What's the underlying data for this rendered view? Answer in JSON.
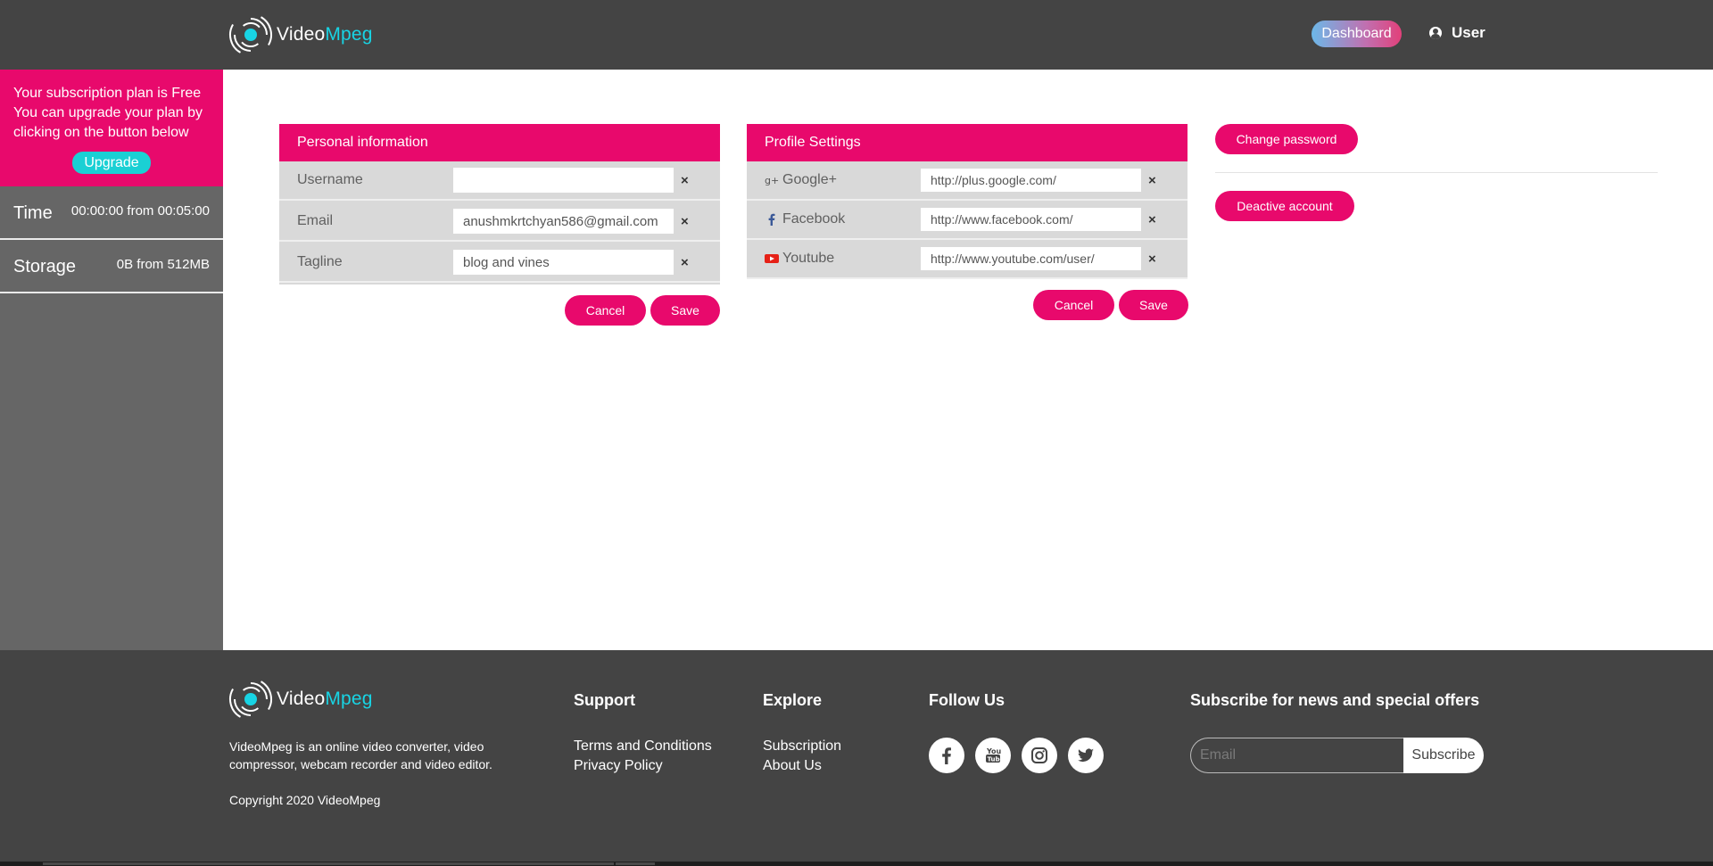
{
  "brand": {
    "name_part1": "Video",
    "name_part2": "Mpeg"
  },
  "header": {
    "dashboard_label": "Dashboard",
    "user_label": "User"
  },
  "sidebar": {
    "plan_text": "Your subscription plan is Free You can upgrade your plan by clicking on the button below",
    "upgrade_label": "Upgrade",
    "time_label": "Time",
    "time_value": "00:00:00 from 00:05:00",
    "storage_label": "Storage",
    "storage_value": "0B from 512MB"
  },
  "personal_info": {
    "title": "Personal information",
    "fields": [
      {
        "label": "Username",
        "value": ""
      },
      {
        "label": "Email",
        "value": "anushmkrtchyan586@gmail.com"
      },
      {
        "label": "Tagline",
        "value": "blog and vines"
      }
    ],
    "clear_symbol": "×",
    "cancel_label": "Cancel",
    "save_label": "Save"
  },
  "profile_settings": {
    "title": "Profile Settings",
    "fields": [
      {
        "label": "Google+",
        "icon": "google-plus-icon",
        "value": "http://plus.google.com/"
      },
      {
        "label": "Facebook",
        "icon": "facebook-icon",
        "value": "http://www.facebook.com/"
      },
      {
        "label": "Youtube",
        "icon": "youtube-icon",
        "value": "http://www.youtube.com/user/"
      }
    ],
    "clear_symbol": "×",
    "cancel_label": "Cancel",
    "save_label": "Save"
  },
  "account": {
    "change_password_label": "Change password",
    "deactivate_label": "Deactive account"
  },
  "footer": {
    "description": "VideoMpeg is an online video converter, video compressor, webcam recorder and video editor.",
    "copyright": "Copyright 2020 VideoMpeg",
    "support_title": "Support",
    "support_links": [
      "Terms and Conditions",
      "Privacy Policy"
    ],
    "explore_title": "Explore",
    "explore_links": [
      "Subscription",
      "About Us"
    ],
    "follow_title": "Follow Us",
    "social_icons": [
      "facebook-icon",
      "youtube-icon",
      "instagram-icon",
      "twitter-icon"
    ],
    "subscribe_title": "Subscribe for news and special offers",
    "email_placeholder": "Email",
    "subscribe_label": "Subscribe"
  },
  "colors": {
    "header_bg": "#444444",
    "accent_pink": "#e8096c",
    "accent_cyan": "#18d4e4",
    "sidebar_bg": "#666666"
  }
}
